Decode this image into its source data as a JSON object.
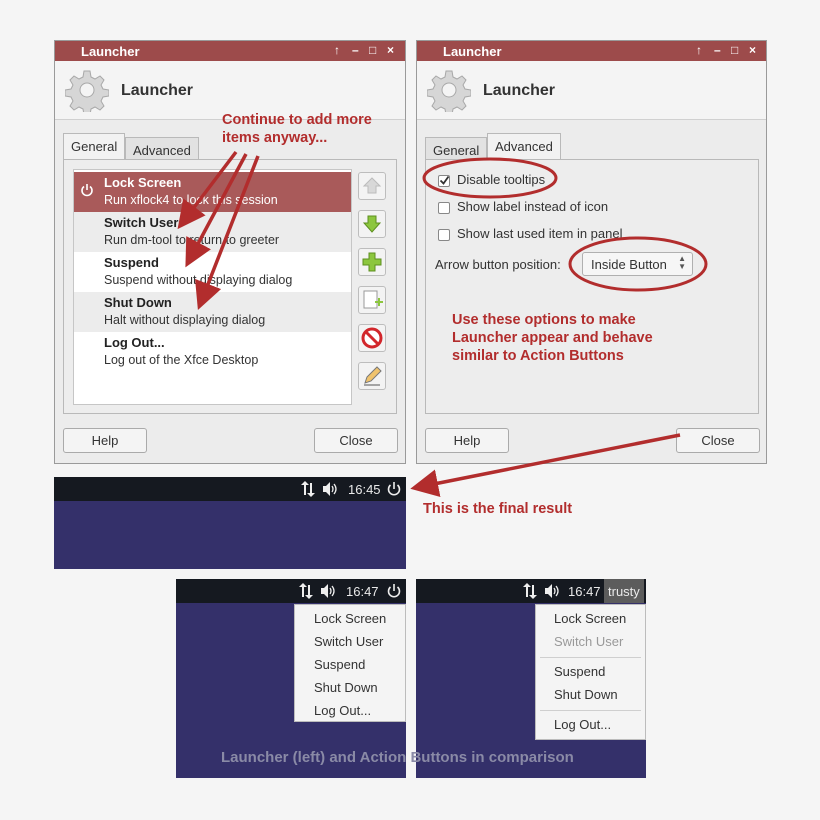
{
  "left_dialog": {
    "title": "Launcher",
    "controls": [
      "↑",
      "–",
      "□",
      "×"
    ],
    "header_title": "Launcher",
    "tabs": [
      {
        "label": "General",
        "active": true
      },
      {
        "label": "Advanced",
        "active": false
      }
    ],
    "items": [
      {
        "name": "Lock Screen",
        "desc": "Run xflock4 to lock this session"
      },
      {
        "name": "Switch User",
        "desc": "Run dm-tool to return to greeter"
      },
      {
        "name": "Suspend",
        "desc": "Suspend without displaying dialog"
      },
      {
        "name": "Shut Down",
        "desc": "Halt without displaying dialog"
      },
      {
        "name": "Log Out...",
        "desc": "Log out of the Xfce Desktop"
      }
    ],
    "side_buttons": [
      "move-up-icon",
      "move-down-icon",
      "add-icon",
      "add-empty-icon",
      "remove-icon",
      "edit-icon"
    ],
    "help_label": "Help",
    "close_label": "Close"
  },
  "right_dialog": {
    "title": "Launcher",
    "controls": [
      "↑",
      "–",
      "□",
      "×"
    ],
    "header_title": "Launcher",
    "tabs": [
      {
        "label": "General",
        "active": false
      },
      {
        "label": "Advanced",
        "active": true
      }
    ],
    "options": {
      "disable_tooltips": {
        "label": "Disable tooltips",
        "checked": true
      },
      "show_label": {
        "label": "Show label instead of icon",
        "checked": false
      },
      "show_last": {
        "label": "Show last used item in panel",
        "checked": false
      }
    },
    "arrow_label": "Arrow button position:",
    "arrow_value": "Inside Button",
    "help_label": "Help",
    "close_label": "Close"
  },
  "annotations": {
    "continue_line1": "Continue to add more",
    "continue_line2": "items anyway...",
    "options_line1": "Use these options to make",
    "options_line2": "Launcher appear and behave",
    "options_line3": "similar to Action Buttons",
    "final_result": "This is the final result",
    "comparison": "Launcher (left) and Action Buttons in comparison"
  },
  "final_panel": {
    "time": "16:45"
  },
  "launcher_panel": {
    "time": "16:47",
    "menu": [
      "Lock Screen",
      "Switch User",
      "Suspend",
      "Shut Down",
      "Log Out..."
    ]
  },
  "action_panel": {
    "time": "16:47",
    "user": "trusty",
    "menu": {
      "lock": "Lock Screen",
      "switch": "Switch User",
      "suspend": "Suspend",
      "shutdown": "Shut Down",
      "logout": "Log Out..."
    }
  },
  "colors": {
    "accent": "#9d4b4b",
    "annotation": "#b22d2d",
    "desktop": "#34306a",
    "panel": "#151920"
  }
}
